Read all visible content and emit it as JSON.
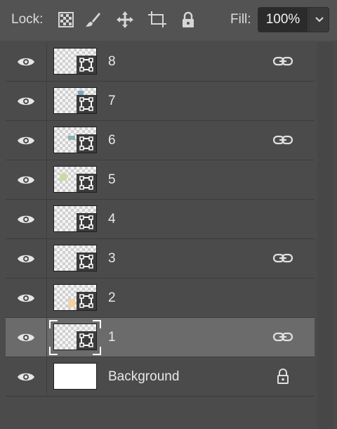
{
  "toolbar": {
    "lock_label": "Lock:",
    "lock_icons": [
      "lock-transparent-pixels-icon",
      "lock-image-pixels-icon",
      "lock-position-icon",
      "lock-artboard-icon",
      "lock-all-icon"
    ],
    "fill_label": "Fill:",
    "fill_value": "100%"
  },
  "layers": [
    {
      "name": "8",
      "linked": true,
      "swatch_color": null
    },
    {
      "name": "7",
      "linked": false,
      "swatch_color": "#7fa7c0"
    },
    {
      "name": "6",
      "linked": true,
      "swatch_color": "#8fb2b5"
    },
    {
      "name": "5",
      "linked": false,
      "swatch_color": "#c8dca0"
    },
    {
      "name": "4",
      "linked": false,
      "swatch_color": null
    },
    {
      "name": "3",
      "linked": true,
      "swatch_color": null
    },
    {
      "name": "2",
      "linked": false,
      "swatch_color": "#f2d2a6"
    },
    {
      "name": "1",
      "linked": true,
      "selected": true,
      "swatch_color": null
    },
    {
      "name": "Background",
      "locked": true,
      "swatch_color": null
    }
  ],
  "colors": {
    "panel_bg": "#4b4b4b",
    "selected_bg": "#6b6b6b",
    "text": "#e8e8e8"
  }
}
